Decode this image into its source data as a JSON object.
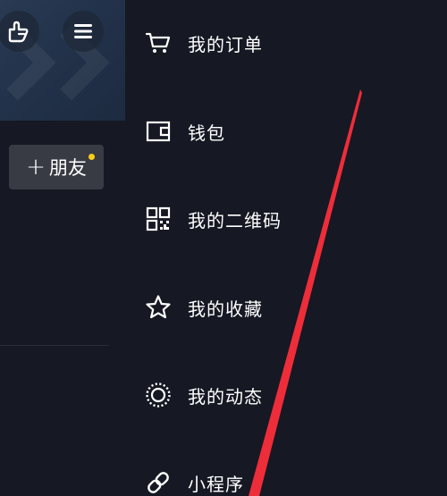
{
  "colors": {
    "background": "#161823",
    "accent_red": "#ee2d3a",
    "notification_dot": "#face15",
    "button_bg": "#393b44"
  },
  "left_pane": {
    "hand_icon": "pointing-hand-icon",
    "menu_icon": "hamburger-menu-icon",
    "add_friend_label": "朋友"
  },
  "drawer": {
    "items": [
      {
        "label": "我的订单",
        "icon": "cart-icon"
      },
      {
        "label": "钱包",
        "icon": "wallet-icon"
      },
      {
        "label": "我的二维码",
        "icon": "qr-code-icon"
      },
      {
        "label": "我的收藏",
        "icon": "star-icon"
      },
      {
        "label": "我的动态",
        "icon": "moments-circle-icon"
      },
      {
        "label": "小程序",
        "icon": "link-icon"
      }
    ]
  }
}
